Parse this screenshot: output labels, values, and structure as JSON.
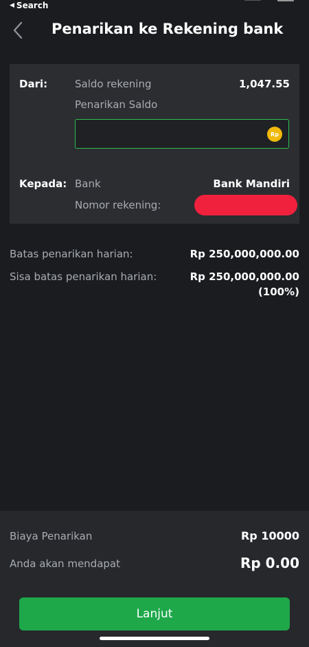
{
  "status_bar": {
    "back_label": "Search"
  },
  "header": {
    "title": "Penarikan ke Rekening bank"
  },
  "from_section": {
    "label": "Dari:",
    "balance_label": "Saldo rekening",
    "balance_value": "1,047.55",
    "withdraw_label": "Penarikan Saldo",
    "amount_value": "",
    "currency_icon": "Rp"
  },
  "to_section": {
    "label": "Kepada:",
    "bank_label": "Bank",
    "bank_value": "Bank Mandiri",
    "account_label": "Nomor rekening:"
  },
  "limits": {
    "daily_label": "Batas penarikan harian:",
    "daily_value": "Rp 250,000,000.00",
    "remaining_label": "Sisa batas penarikan harian:",
    "remaining_value": "Rp 250,000,000.00",
    "remaining_percent": "(100%)"
  },
  "summary": {
    "fee_label": "Biaya Penarikan",
    "fee_value": "Rp 10000",
    "receive_label": "Anda akan mendapat",
    "receive_value": "Rp 0.00"
  },
  "actions": {
    "continue_label": "Lanjut"
  },
  "colors": {
    "background": "#1a1c1f",
    "panel": "#2b2d31",
    "accent_green": "#1ea84a",
    "input_border": "#2fbf4f",
    "coin_yellow": "#f0b90b",
    "redaction": "#f0213d"
  }
}
